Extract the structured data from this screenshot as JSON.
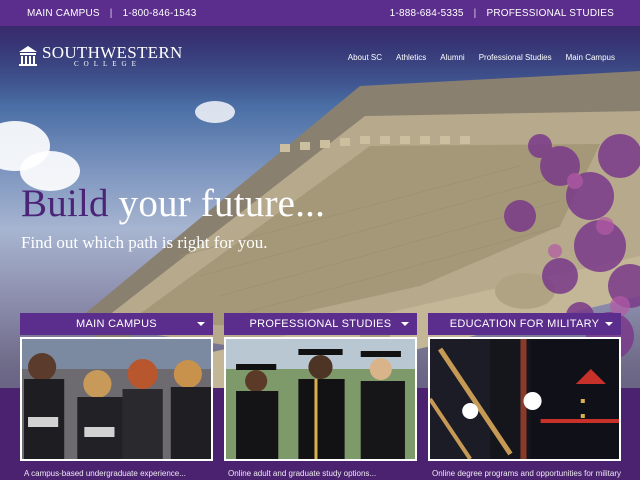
{
  "topbar": {
    "main_campus": "MAIN CAMPUS",
    "main_phone": "1-800-846-1543",
    "pro_phone": "1-888-684-5335",
    "pro_studies": "PROFESSIONAL STUDIES"
  },
  "logo": {
    "name": "SOUTHWESTERN",
    "sub": "COLLEGE"
  },
  "nav": {
    "items": [
      "About SC",
      "Athletics",
      "Alumni",
      "Professional Studies",
      "Main Campus"
    ]
  },
  "hero": {
    "headline_accent": "Build",
    "headline_rest": " your future...",
    "subline": "Find out which path is right for you."
  },
  "cards": [
    {
      "title": "MAIN CAMPUS",
      "desc": "A campus-based undergraduate experience..."
    },
    {
      "title": "PROFESSIONAL STUDIES",
      "desc": "Online adult and graduate study options..."
    },
    {
      "title": "EDUCATION FOR MILITARY",
      "desc": "Online degree programs and opportunities for military..."
    }
  ],
  "colors": {
    "brand_purple": "#5b2d8c",
    "band_purple": "#4b2270",
    "accent_purple": "#4b2478"
  }
}
